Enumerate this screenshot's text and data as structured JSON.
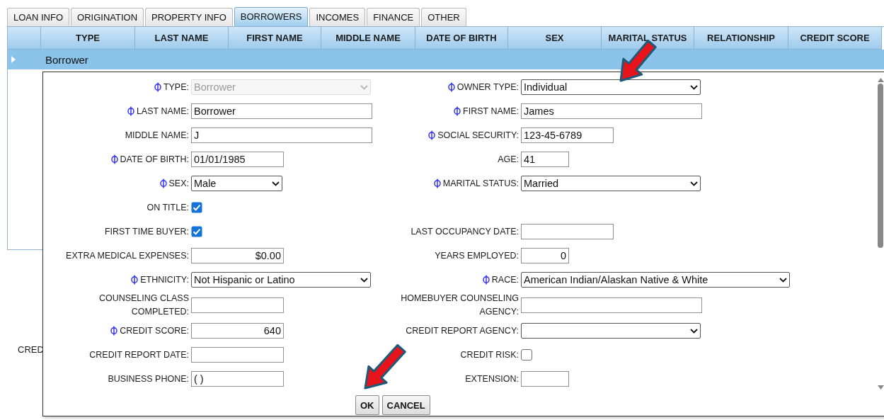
{
  "tabs": [
    {
      "label": "LOAN INFO",
      "selected": false
    },
    {
      "label": "ORIGINATION",
      "selected": false
    },
    {
      "label": "PROPERTY INFO",
      "selected": false
    },
    {
      "label": "BORROWERS",
      "selected": true
    },
    {
      "label": "INCOMES",
      "selected": false
    },
    {
      "label": "FINANCE",
      "selected": false
    },
    {
      "label": "OTHER",
      "selected": false
    }
  ],
  "grid": {
    "columns": [
      "TYPE",
      "LAST NAME",
      "FIRST NAME",
      "MIDDLE NAME",
      "DATE OF BIRTH",
      "SEX",
      "MARITAL STATUS",
      "RELATIONSHIP",
      "CREDIT SCORE"
    ],
    "rows": [
      {
        "selected": true,
        "type": "Borrower"
      }
    ]
  },
  "background_label": "CRED",
  "dialog": {
    "rows": [
      {
        "left": {
          "label": "TYPE:",
          "required": true,
          "kind": "select",
          "value": "Borrower",
          "disabled": true
        },
        "right": {
          "label": "OWNER TYPE:",
          "required": true,
          "kind": "select",
          "value": "Individual",
          "disabled": false
        }
      },
      {
        "left": {
          "label": "LAST NAME:",
          "required": true,
          "kind": "text",
          "value": "Borrower"
        },
        "right": {
          "label": "FIRST NAME:",
          "required": true,
          "kind": "text",
          "value": "James"
        }
      },
      {
        "left": {
          "label": "MIDDLE NAME:",
          "required": false,
          "kind": "text",
          "value": "J"
        },
        "right": {
          "label": "SOCIAL SECURITY:",
          "required": true,
          "kind": "text",
          "value": "123-45-6789"
        }
      },
      {
        "left": {
          "label": "DATE OF BIRTH:",
          "required": true,
          "kind": "text",
          "value": "01/01/1985"
        },
        "right": {
          "label": "AGE:",
          "required": false,
          "kind": "text",
          "value": "41"
        }
      },
      {
        "left": {
          "label": "SEX:",
          "required": true,
          "kind": "select",
          "value": "Male",
          "disabled": false
        },
        "right": {
          "label": "MARITAL STATUS:",
          "required": true,
          "kind": "select",
          "value": "Married",
          "disabled": false
        }
      },
      {
        "left": {
          "label": "ON TITLE:",
          "required": false,
          "kind": "checkbox",
          "checked": true
        }
      },
      {
        "left": {
          "label": "FIRST TIME BUYER:",
          "required": false,
          "kind": "checkbox",
          "checked": true
        },
        "right": {
          "label": "LAST OCCUPANCY DATE:",
          "required": false,
          "kind": "text"
        }
      },
      {
        "left": {
          "label": "EXTRA MEDICAL EXPENSES:",
          "required": false,
          "kind": "number",
          "value": "$0.00"
        },
        "right": {
          "label": "YEARS EMPLOYED:",
          "required": false,
          "kind": "number",
          "value": "0"
        }
      },
      {
        "left": {
          "label": "ETHNICITY:",
          "required": true,
          "kind": "select",
          "value": "Not Hispanic or Latino",
          "disabled": false
        },
        "right": {
          "label": "RACE:",
          "required": true,
          "kind": "select",
          "value": "American Indian/Alaskan Native & White",
          "disabled": false
        }
      },
      {
        "left": {
          "label": "COUNSELING CLASS\nCOMPLETED:",
          "required": false,
          "kind": "text"
        },
        "right": {
          "label": "HOMEBUYER COUNSELING\nAGENCY:",
          "required": false,
          "kind": "text"
        }
      },
      {
        "left": {
          "label": "CREDIT SCORE:",
          "required": true,
          "kind": "number",
          "value": "640"
        },
        "right": {
          "label": "CREDIT REPORT AGENCY:",
          "required": false,
          "kind": "select",
          "disabled": false
        }
      },
      {
        "left": {
          "label": "CREDIT REPORT DATE:",
          "required": false,
          "kind": "text"
        },
        "right": {
          "label": "CREDIT RISK:",
          "required": false,
          "kind": "checkbox",
          "checked": false
        }
      },
      {
        "left": {
          "label": "BUSINESS PHONE:",
          "required": false,
          "kind": "text",
          "value": "( )"
        },
        "right": {
          "label": "EXTENSION:",
          "required": false,
          "kind": "text"
        }
      }
    ],
    "buttons": [
      "OK",
      "CANCEL"
    ]
  }
}
